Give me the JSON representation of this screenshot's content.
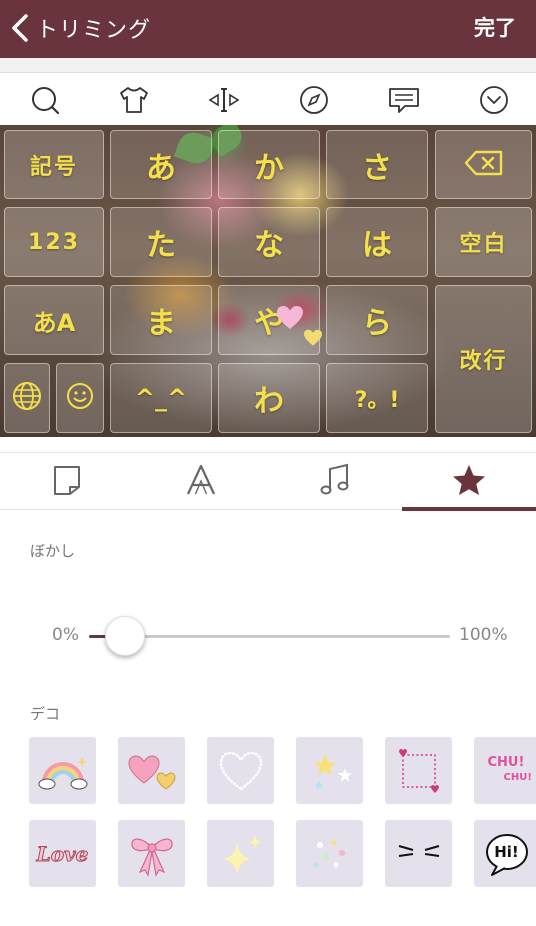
{
  "header": {
    "title": "トリミング",
    "done_label": "完了"
  },
  "toolbar": {
    "icons": [
      "search-icon",
      "shirt-icon",
      "resize-icon",
      "compass-icon",
      "comment-icon",
      "chevron-down-icon"
    ]
  },
  "keyboard": {
    "symbols_label": "記号",
    "number_label": "123",
    "kana_alpha_label": "あA",
    "space_label": "空白",
    "enter_label": "改行",
    "kana": {
      "a": "あ",
      "ka": "か",
      "sa": "さ",
      "ta": "た",
      "na": "な",
      "ha": "は",
      "ma": "ま",
      "ya": "や",
      "ra": "ら",
      "wa": "わ",
      "punct": "?。!",
      "kaomoji": "^_^"
    }
  },
  "tabs": {
    "items": [
      "background-tab",
      "font-tab",
      "sound-tab",
      "effect-tab"
    ],
    "selected": "effect-tab"
  },
  "blur": {
    "label": "ぼかし",
    "min_label": "0%",
    "max_label": "100%",
    "value": 0.1
  },
  "deco": {
    "label": "デコ",
    "items": [
      "rainbow",
      "hearts",
      "heart-frame",
      "stars",
      "square-frame",
      "chu-chu",
      "love",
      "ribbon",
      "sparkles",
      "glitter",
      "whiskers",
      "hi-bubble"
    ],
    "chu_text_1": "CHU!",
    "chu_text_2": "CHU!",
    "love_text": "Love",
    "hi_text": "Hi!"
  },
  "colors": {
    "brand": "#6a343c",
    "key_text": "#f4e04a"
  }
}
